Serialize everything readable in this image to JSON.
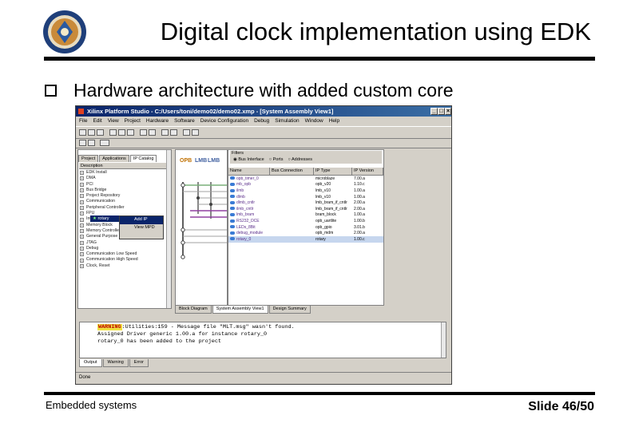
{
  "slide": {
    "title": "Digital clock implementation using EDK",
    "bullet": "Hardware architecture with added custom core",
    "footer_left": "Embedded systems",
    "footer_right": "Slide 46/50"
  },
  "window": {
    "title": "Xilinx Platform Studio - C:/Users/toni/demo02/demo02.xmp - [System Assembly View1]",
    "menu": [
      "File",
      "Edit",
      "View",
      "Project",
      "Hardware",
      "Software",
      "Device Configuration",
      "Debug",
      "Simulation",
      "Window",
      "Help"
    ],
    "left_tabs": [
      "Project",
      "Applications",
      "IP Catalog"
    ],
    "left_header": "Description",
    "catalog_items": [
      "EDK Install",
      "DMA",
      "PCI",
      "Bus Bridge",
      "Project Repository",
      "Communication",
      "Peripheral Controller",
      "FPU",
      "Interrupt Controller",
      "Memory Block",
      "Memory Controller",
      "General Purpose IO",
      "JTAG",
      "Debug",
      "Communication Low Speed",
      "Communication High Speed",
      "Clock, Reset"
    ],
    "selected_item": "rotary",
    "context_menu": [
      "Add IP",
      "View MPD"
    ],
    "bus_labels": [
      "OPB",
      "LMB",
      "LMB"
    ],
    "filters_label": "Filters",
    "filter_options": [
      "Bus Interface",
      "Ports",
      "Addresses"
    ],
    "columns": [
      "Name",
      "Bus Connection",
      "IP Type",
      "IP Version"
    ],
    "rows": [
      {
        "name": "opb_timer_0",
        "bus": "",
        "type": "microblaze",
        "ver": "7.00.a"
      },
      {
        "name": "mb_opb",
        "bus": "",
        "type": "opb_v20",
        "ver": "1.10.c"
      },
      {
        "name": "ilmb",
        "bus": "",
        "type": "lmb_v10",
        "ver": "1.00.a"
      },
      {
        "name": "dlmb",
        "bus": "",
        "type": "lmb_v10",
        "ver": "1.00.a"
      },
      {
        "name": "dlmb_cntlr",
        "bus": "",
        "type": "lmb_bram_if_cntlr",
        "ver": "2.00.a"
      },
      {
        "name": "ilmb_cntlr",
        "bus": "",
        "type": "lmb_bram_if_cntlr",
        "ver": "2.00.a"
      },
      {
        "name": "lmb_bram",
        "bus": "",
        "type": "bram_block",
        "ver": "1.00.a"
      },
      {
        "name": "RS232_DCE",
        "bus": "",
        "type": "opb_uartlite",
        "ver": "1.00.b"
      },
      {
        "name": "LEDs_8Bit",
        "bus": "",
        "type": "opb_gpio",
        "ver": "3.01.b"
      },
      {
        "name": "debug_module",
        "bus": "",
        "type": "opb_mdm",
        "ver": "2.00.a"
      },
      {
        "name": "rotary_0",
        "bus": "",
        "type": "rotary",
        "ver": "1.00.c"
      }
    ],
    "view_tabs": [
      "Block Diagram",
      "System Assembly View1",
      "Design Summary"
    ],
    "console": [
      {
        "badge": "WARNING",
        "text": ":Utilities:159 - Message file \"MLT.msg\" wasn't found."
      },
      {
        "badge": "",
        "text": "Assigned Driver generic 1.00.a for instance rotary_0"
      },
      {
        "badge": "",
        "text": "rotary_0 has been added to the project"
      }
    ],
    "console_tabs": [
      "Output",
      "Warning",
      "Error"
    ],
    "status": "Done"
  }
}
